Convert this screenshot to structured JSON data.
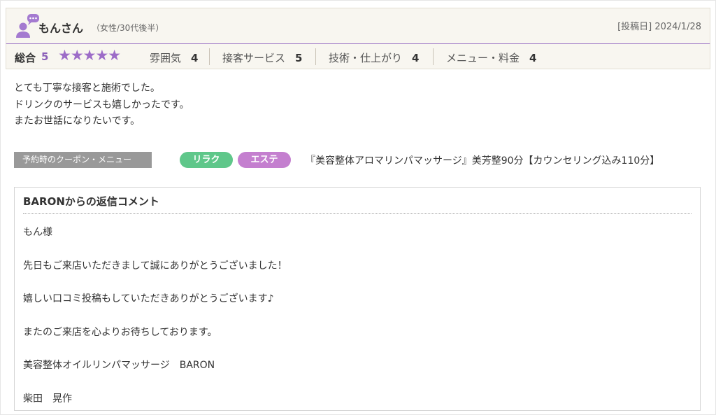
{
  "review": {
    "reviewer_name": "もんさん",
    "reviewer_meta": "（女性/30代後半）",
    "post_date": "[投稿日] 2024/1/28",
    "ratings": {
      "total_label": "総合",
      "total_score": "5",
      "stars": "★★★★★",
      "star_count": 5,
      "star_color": "#9d6cc8",
      "categories": [
        {
          "label": "雰囲気",
          "score": "4"
        },
        {
          "label": "接客サービス",
          "score": "5"
        },
        {
          "label": "技術・仕上がり",
          "score": "4"
        },
        {
          "label": "メニュー・料金",
          "score": "4"
        }
      ]
    },
    "body_lines": [
      "とても丁寧な接客と施術でした。",
      "ドリンクのサービスも嬉しかったです。",
      "またお世話になりたいです。"
    ],
    "coupon": {
      "label": "予約時のクーポン・メニュー",
      "tags": [
        {
          "text": "リラク",
          "color": "#5fc78a"
        },
        {
          "text": "エステ",
          "color": "#c47fcf"
        }
      ],
      "name": "『美容整体アロマリンパマッサージ』美芳整90分【カウンセリング込み110分】"
    },
    "reply": {
      "title": "BARONからの返信コメント",
      "lines": [
        "もん様",
        "",
        "先日もご来店いただきまして誠にありがとうございました！",
        "",
        "嬉しい口コミ投稿もしていただきありがとうございます♪",
        "",
        "またのご来店を心よりお待ちしております。",
        "",
        "美容整体オイルリンパマッサージ　BARON",
        "",
        "柴田　晃作"
      ]
    }
  }
}
